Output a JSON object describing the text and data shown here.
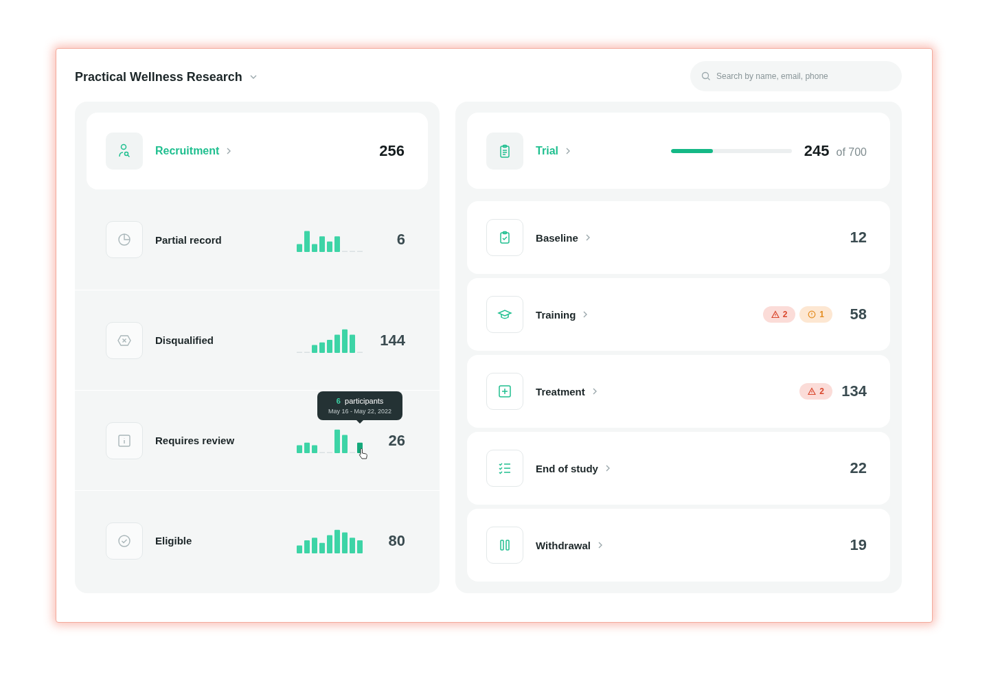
{
  "header": {
    "title": "Practical Wellness Research"
  },
  "search": {
    "placeholder": "Search by name, email, phone"
  },
  "recruitment": {
    "label": "Recruitment",
    "count": "256",
    "rows": [
      {
        "label": "Partial record",
        "count": "6"
      },
      {
        "label": "Disqualified",
        "count": "144"
      },
      {
        "label": "Requires review",
        "count": "26",
        "tooltip": {
          "count": "6",
          "unit": "participants",
          "dates": "May 16 - May 22, 2022"
        }
      },
      {
        "label": "Eligible",
        "count": "80"
      }
    ]
  },
  "trial": {
    "label": "Trial",
    "level": 0.35,
    "count": "245",
    "total": "of 700",
    "stages": [
      {
        "label": "Baseline",
        "count": "12"
      },
      {
        "label": "Training",
        "count": "58",
        "badges": [
          {
            "kind": "alert",
            "count": "2"
          },
          {
            "kind": "warning",
            "count": "1"
          }
        ]
      },
      {
        "label": "Treatment",
        "count": "134",
        "badges": [
          {
            "kind": "alert",
            "count": "2"
          }
        ]
      },
      {
        "label": "End of study",
        "count": "22"
      },
      {
        "label": "Withdrawal",
        "count": "19"
      }
    ]
  }
}
